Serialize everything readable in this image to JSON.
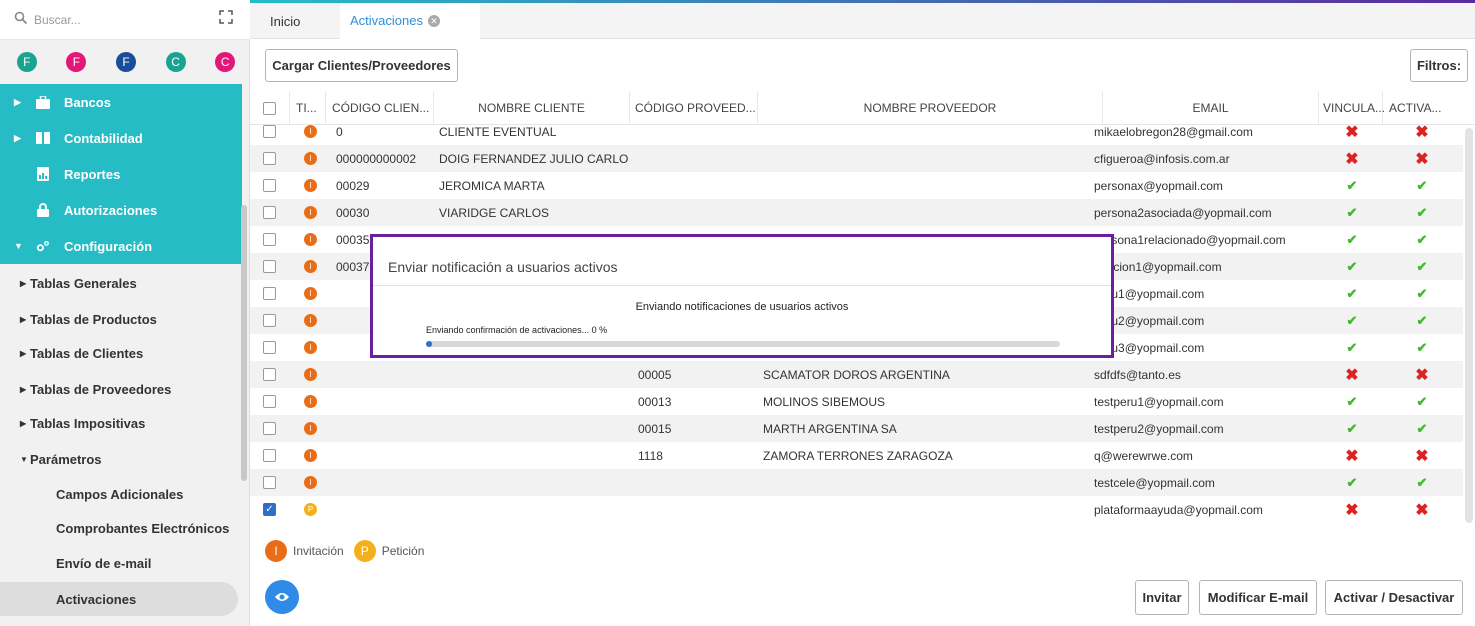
{
  "sidebar": {
    "search_placeholder": "Buscar...",
    "avatars": [
      {
        "letter": "F",
        "color": "#1aa392"
      },
      {
        "letter": "F",
        "color": "#e3167a"
      },
      {
        "letter": "F",
        "color": "#1a4e9a"
      },
      {
        "letter": "C",
        "color": "#1aa392"
      },
      {
        "letter": "C",
        "color": "#e3167a"
      }
    ],
    "main_items": [
      {
        "label": "Bancos",
        "icon": "briefcase-icon"
      },
      {
        "label": "Contabilidad",
        "icon": "book-icon"
      },
      {
        "label": "Reportes",
        "icon": "report-icon"
      },
      {
        "label": "Autorizaciones",
        "icon": "lock-icon"
      },
      {
        "label": "Configuración",
        "icon": "gears-icon"
      }
    ],
    "sub_items": [
      "Tablas Generales",
      "Tablas de Productos",
      "Tablas de Clientes",
      "Tablas de Proveedores",
      "Tablas Impositivas",
      "Parámetros"
    ],
    "param_items": [
      "Campos Adicionales",
      "Comprobantes Electrónicos",
      "Envío de e-mail",
      "Activaciones"
    ],
    "accent": "#26bcc6"
  },
  "tabs": {
    "inicio": "Inicio",
    "activaciones": "Activaciones"
  },
  "toolbar": {
    "cargar": "Cargar Clientes/Proveedores",
    "filtros": "Filtros:"
  },
  "table": {
    "headers": [
      "TI...",
      "CÓDIGO CLIEN...",
      "NOMBRE CLIENTE",
      "CÓDIGO PROVEED...",
      "NOMBRE PROVEEDOR",
      "EMAIL",
      "VINCULA...",
      "ACTIVA..."
    ],
    "rows": [
      {
        "checked": false,
        "type": "I",
        "cod_cli": "0",
        "nom_cli": "CLIENTE EVENTUAL",
        "cod_prov": "",
        "nom_prov": "",
        "email": "mikaelobregon28@gmail.com",
        "vinc": "x",
        "act": "x"
      },
      {
        "checked": false,
        "type": "I",
        "cod_cli": "000000000002",
        "nom_cli": "DOIG FERNANDEZ JULIO CARLOS",
        "cod_prov": "",
        "nom_prov": "",
        "email": "cfigueroa@infosis.com.ar",
        "vinc": "x",
        "act": "x"
      },
      {
        "checked": false,
        "type": "I",
        "cod_cli": "00029",
        "nom_cli": "JEROMICA MARTA",
        "cod_prov": "",
        "nom_prov": "",
        "email": "personax@yopmail.com",
        "vinc": "ok",
        "act": "ok"
      },
      {
        "checked": false,
        "type": "I",
        "cod_cli": "00030",
        "nom_cli": "VIARIDGE CARLOS",
        "cod_prov": "",
        "nom_prov": "",
        "email": "persona2asociada@yopmail.com",
        "vinc": "ok",
        "act": "ok"
      },
      {
        "checked": false,
        "type": "I",
        "cod_cli": "00035",
        "nom_cli": "",
        "cod_prov": "",
        "nom_prov": "",
        "email": "persona1relacionado@yopmail.com",
        "vinc": "ok",
        "act": "ok"
      },
      {
        "checked": false,
        "type": "I",
        "cod_cli": "00037",
        "nom_cli": "",
        "cod_prov": "",
        "nom_prov": "",
        "email": "peticion1@yopmail.com",
        "vinc": "ok",
        "act": "ok"
      },
      {
        "checked": false,
        "type": "I",
        "cod_cli": "",
        "nom_cli": "",
        "cod_prov": "",
        "nom_prov": "",
        "email": "peru1@yopmail.com",
        "vinc": "ok",
        "act": "ok"
      },
      {
        "checked": false,
        "type": "I",
        "cod_cli": "",
        "nom_cli": "",
        "cod_prov": "",
        "nom_prov": "",
        "email": "peru2@yopmail.com",
        "vinc": "ok",
        "act": "ok"
      },
      {
        "checked": false,
        "type": "I",
        "cod_cli": "",
        "nom_cli": "",
        "cod_prov": "",
        "nom_prov": "",
        "email": "peru3@yopmail.com",
        "vinc": "ok",
        "act": "ok"
      },
      {
        "checked": false,
        "type": "I",
        "cod_cli": "",
        "nom_cli": "",
        "cod_prov": "00005",
        "nom_prov": "SCAMATOR DOROS ARGENTINA",
        "email": "sdfdfs@tanto.es",
        "vinc": "x",
        "act": "x"
      },
      {
        "checked": false,
        "type": "I",
        "cod_cli": "",
        "nom_cli": "",
        "cod_prov": "00013",
        "nom_prov": "MOLINOS SIBEMOUS",
        "email": "testperu1@yopmail.com",
        "vinc": "ok",
        "act": "ok"
      },
      {
        "checked": false,
        "type": "I",
        "cod_cli": "",
        "nom_cli": "",
        "cod_prov": "00015",
        "nom_prov": "MARTH ARGENTINA SA",
        "email": "testperu2@yopmail.com",
        "vinc": "ok",
        "act": "ok"
      },
      {
        "checked": false,
        "type": "I",
        "cod_cli": "",
        "nom_cli": "",
        "cod_prov": "1118",
        "nom_prov": "ZAMORA TERRONES ZARAGOZA",
        "email": "q@werewrwe.com",
        "vinc": "x",
        "act": "x"
      },
      {
        "checked": false,
        "type": "I",
        "cod_cli": "",
        "nom_cli": "",
        "cod_prov": "",
        "nom_prov": "",
        "email": "testcele@yopmail.com",
        "vinc": "ok",
        "act": "ok"
      },
      {
        "checked": true,
        "type": "P",
        "cod_cli": "",
        "nom_cli": "",
        "cod_prov": "",
        "nom_prov": "",
        "email": "plataformaayuda@yopmail.com",
        "vinc": "x",
        "act": "x"
      }
    ]
  },
  "legend": {
    "invitacion": "Invitación",
    "peticion": "Petición",
    "invitacion_letter": "I",
    "peticion_letter": "P"
  },
  "footer": {
    "invitar": "Invitar",
    "modificar": "Modificar E-mail",
    "activar": "Activar / Desactivar"
  },
  "modal": {
    "title": "Enviar notificación a usuarios activos",
    "message": "Enviando notificaciones de usuarios activos",
    "progress_label": "Enviando confirmación de activaciones... 0 %",
    "progress_fraction": 0.01
  }
}
